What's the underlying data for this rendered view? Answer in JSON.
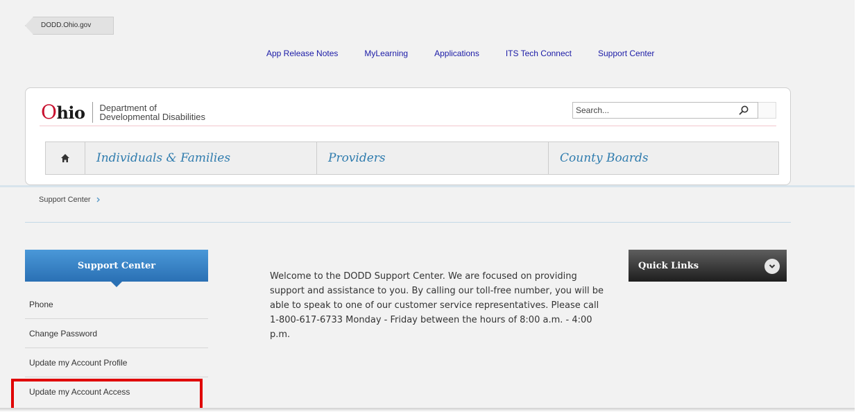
{
  "back_tab": {
    "label": "DODD.Ohio.gov"
  },
  "top_links": [
    "App Release Notes",
    "MyLearning",
    "Applications",
    "ITS Tech Connect",
    "Support Center"
  ],
  "logo": {
    "state_first": "O",
    "state_rest": "hio",
    "dept_line1": "Department of",
    "dept_line2": "Developmental Disabilities"
  },
  "search": {
    "placeholder": "Search..."
  },
  "nav": {
    "items": [
      "Individuals & Families",
      "Providers",
      "County Boards"
    ]
  },
  "breadcrumb": {
    "items": [
      "Support Center"
    ]
  },
  "sidebar": {
    "title": "Support Center",
    "items": [
      "Phone",
      "Change Password",
      "Update my Account Profile",
      "Update my Account Access"
    ]
  },
  "main": {
    "welcome_text": "Welcome to the DODD Support Center.  We are focused on providing support and assistance to you.  By calling our toll-free number, you will be able to speak to one of our customer service representatives.  Please call 1-800-617-6733 Monday - Friday between the hours of 8:00 a.m. - 4:00 p.m."
  },
  "quick_links": {
    "label": "Quick Links"
  },
  "colors": {
    "page_bg": "#f2f2f2",
    "link_blue": "#1a1aa6",
    "nav_text": "#2f7cae",
    "sidebar_header": "#2a70b4",
    "highlight_red": "#e00000",
    "ohio_red": "#c8102e"
  },
  "icons": {
    "home": "home-icon",
    "search": "search-icon",
    "breadcrumb_sep": "chevron-right-icon",
    "quick_links_toggle": "chevron-down-icon"
  }
}
